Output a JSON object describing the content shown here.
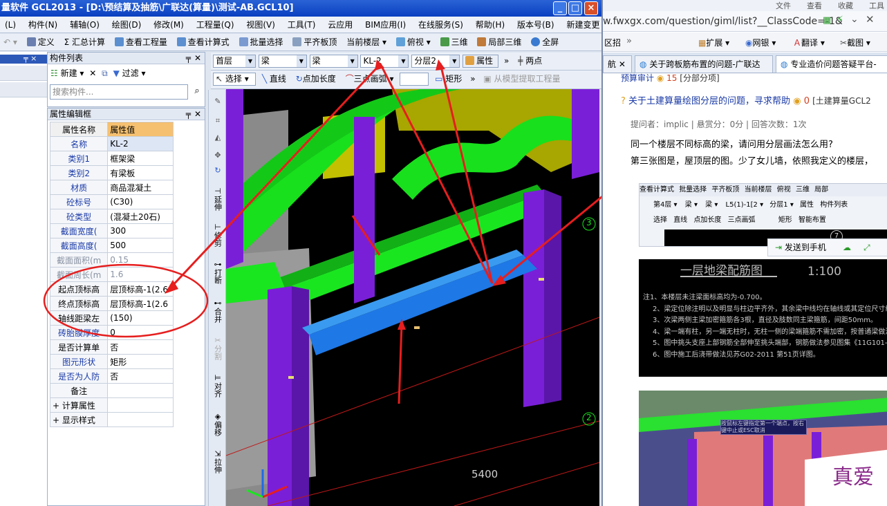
{
  "app": {
    "title": "量软件 GCL2013 - [D:\\预结算及抽筋\\广联达(算量)\\测试-AB.GCL10]",
    "window_controls": [
      "_",
      "□",
      "×"
    ],
    "menu": [
      "(L)",
      "构件(N)",
      "辅轴(O)",
      "绘图(D)",
      "修改(M)",
      "工程量(Q)",
      "视图(V)",
      "工具(T)",
      "云应用",
      "BIM应用(I)",
      "在线服务(S)",
      "帮助(H)",
      "版本号(B)",
      "新建变更",
      "登录"
    ],
    "toolbar": [
      "定义",
      "Σ 汇总计算",
      "查看工程量",
      "查看计算式",
      "批量选择",
      "平齐板顶",
      "当前楼层",
      "俯视",
      "三维",
      "局部三维",
      "全屏"
    ],
    "component_list": {
      "title": "构件列表",
      "new_label": "新建",
      "filter_label": "过滤",
      "search_placeholder": "搜索构件..."
    },
    "property_panel": {
      "title": "属性编辑框",
      "header": {
        "name": "属性名称",
        "value": "属性值"
      },
      "rows": [
        {
          "name": "名称",
          "value": "KL-2"
        },
        {
          "name": "类别1",
          "value": "框架梁"
        },
        {
          "name": "类别2",
          "value": "有梁板"
        },
        {
          "name": "材质",
          "value": "商品混凝土"
        },
        {
          "name": "砼标号",
          "value": "(C30)"
        },
        {
          "name": "砼类型",
          "value": "(混凝土20石)"
        },
        {
          "name": "截面宽度(",
          "value": "300"
        },
        {
          "name": "截面高度(",
          "value": "500"
        },
        {
          "name": "截面面积(m",
          "value": "0.15"
        },
        {
          "name": "截面周长(m",
          "value": "1.6"
        },
        {
          "name": "起点顶标高",
          "value": "层顶标高-1(2.6"
        },
        {
          "name": "终点顶标高",
          "value": "层顶标高-1(2.6"
        },
        {
          "name": "轴线距梁左",
          "value": "(150)"
        },
        {
          "name": "砖胎膜厚度",
          "value": "0"
        },
        {
          "name": "是否计算单",
          "value": "否"
        },
        {
          "name": "图元形状",
          "value": "矩形"
        },
        {
          "name": "是否为人防",
          "value": "否"
        },
        {
          "name": "备注",
          "value": ""
        },
        {
          "name": "+ 计算属性",
          "value": ""
        },
        {
          "name": "+ 显示样式",
          "value": ""
        }
      ]
    },
    "floor_toolbar": {
      "floor": "首层",
      "type1": "梁",
      "type2": "梁",
      "component": "KL-2",
      "layer": "分层2",
      "properties_label": "属性",
      "two_points_label": "两点"
    },
    "draw_toolbar": [
      "选择",
      "直线",
      "点加长度",
      "三点画弧",
      "矩形",
      "从模型提取工程量"
    ],
    "vertical_tools": [
      "延伸",
      "修剪",
      "打断",
      "合并",
      "分割",
      "对齐",
      "偏移",
      "拉伸"
    ],
    "viewport": {
      "dimension_label": "5400",
      "axis_labels": [
        "3",
        "2"
      ]
    }
  },
  "browser": {
    "top_menu": [
      "文件",
      "查看",
      "收藏",
      "工具"
    ],
    "url": "w.fwxgx.com/question/giml/list?__ClassCode=-1&",
    "toolbar": [
      "区招",
      "扩展",
      "网银",
      "翻译",
      "截图"
    ],
    "tabs": [
      "航",
      "关于跨板筋布置的问题-广联达",
      "专业造价问题答疑平台-"
    ],
    "question": {
      "prev_line": "预算审计",
      "prev_count": "15",
      "prev_tag": "[分部分项]",
      "title": "关于土建算量绘图分层的问题，寻求帮助",
      "count": "0",
      "tag": "[土建算量GCL2",
      "meta": "提问者：implic  |  悬赏分：0分  |  回答次数：1次",
      "body1": "同一个楼层不同标高的梁，请问用分层画法怎么用?",
      "body2": "第三张图是，屋顶层的图。少了女儿墙，依照我定义的楼层，"
    },
    "embedded_toolbar": {
      "items1": [
        "查看计算式",
        "批量选择",
        "平齐板顶",
        "当前楼层",
        "俯视",
        "三维",
        "局部"
      ],
      "floor": "第4层",
      "type1": "梁",
      "type2": "梁",
      "component": "L5(1)-1[2",
      "layer": "分层1",
      "properties": "属性",
      "complist": "构件列表",
      "draw": [
        "选择",
        "直线",
        "点加长度",
        "三点画弧",
        "矩形",
        "智能布置"
      ],
      "axis": "7"
    },
    "send_to_phone": "发送到手机",
    "drawing": {
      "title": "一层地梁配筋图",
      "scale": "1:100",
      "notes": [
        "注1、本楼层未注梁面标高均为-0.700。",
        "2、梁定位除注明以及明显与柱边平齐外，其余梁中线均在轴线或其定位尺寸线上。",
        "3、次梁两侧主梁加密箍筋各3根，直径及肢数同主梁箍筋，间距50mm。",
        "4、梁一端有柱，另一端无柱时，无柱一侧的梁端箍筋不需加密，按普通梁做法；有柱一侧的梁端箍筋加密",
        "5、图中挑头支座上部钢筋全部伸至挑头端部，钢筋做法参见图集《11G101-1》和结构设计总说明",
        "6、图中施工后浇带做法见苏G02-2011 第51页详图。"
      ]
    },
    "tooltip": "按鼠标左键指定第一个端点，按右键中止或ESC取消",
    "ad_text": "真爱"
  },
  "colors": {
    "beam_green": "#19e61e",
    "beam_blue": "#1e78e6",
    "column_purple": "#7a1fd8",
    "slab_yellow": "#b4b400",
    "arrow_red": "#e61e1e"
  }
}
